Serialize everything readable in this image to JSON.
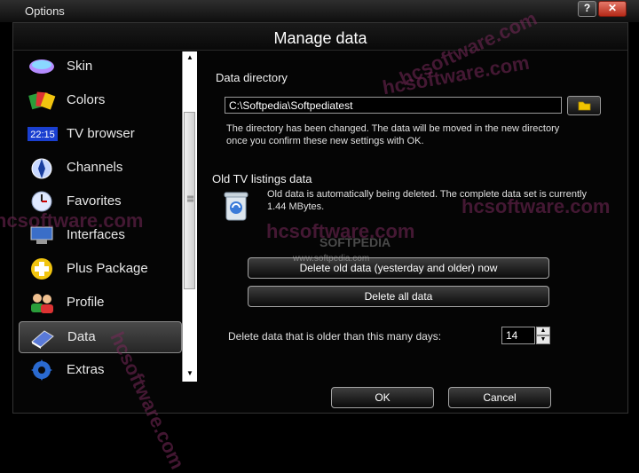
{
  "window": {
    "title": "Options",
    "help_label": "?",
    "close_label": "✕"
  },
  "header": {
    "title": "Manage data"
  },
  "sidebar": {
    "items": [
      {
        "label": "Skin",
        "icon": "skin-icon"
      },
      {
        "label": "Colors",
        "icon": "colors-icon"
      },
      {
        "label": "TV browser",
        "icon": "tv-browser-icon",
        "badge": "22:15"
      },
      {
        "label": "Channels",
        "icon": "channels-icon"
      },
      {
        "label": "Favorites",
        "icon": "favorites-icon"
      },
      {
        "label": "Interfaces",
        "icon": "interfaces-icon"
      },
      {
        "label": "Plus Package",
        "icon": "plus-package-icon"
      },
      {
        "label": "Profile",
        "icon": "profile-icon"
      },
      {
        "label": "Data",
        "icon": "data-icon",
        "active": true
      },
      {
        "label": "Extras",
        "icon": "extras-icon"
      }
    ]
  },
  "data_directory": {
    "title": "Data directory",
    "path": "C:\\Softpedia\\Softpediatest",
    "note_line1": "The directory has been changed. The data will be moved in the new directory",
    "note_line2": "once you confirm these new settings with OK."
  },
  "old_listings": {
    "title": "Old TV listings data",
    "info_line1": "Old data is automatically being deleted. The complete data set is currently",
    "info_line2": "1.44 MBytes.",
    "delete_old_label": "Delete old data (yesterday and older) now",
    "delete_all_label": "Delete all data",
    "days_label": "Delete data that is older than this many days:",
    "days_value": "14"
  },
  "footer": {
    "ok_label": "OK",
    "cancel_label": "Cancel"
  },
  "watermarks": {
    "text1": "hcsoftware.com",
    "text2": "www.softpedia.com",
    "text3": "SOFTPEDIA"
  },
  "colors": {
    "accent_close": "#c0392b",
    "folder_yellow": "#f2c400",
    "active_bg": "#3a3a3a"
  }
}
